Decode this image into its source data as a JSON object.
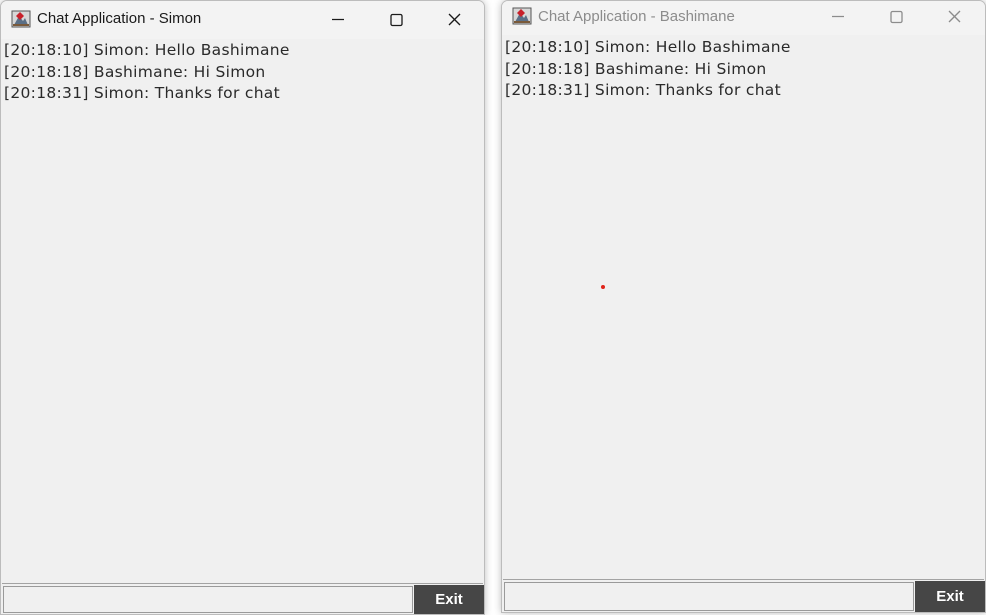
{
  "windows": {
    "left": {
      "title": "Chat Application - Simon",
      "messages": [
        "[20:18:10] Simon: Hello Bashimane",
        "[20:18:18] Bashimane: Hi Simon",
        "[20:18:31] Simon: Thanks for chat"
      ],
      "input_value": "",
      "exit_label": "Exit",
      "active": true
    },
    "right": {
      "title": "Chat Application - Bashimane",
      "messages": [
        "[20:18:10] Simon: Hello Bashimane",
        "[20:18:18] Bashimane: Hi Simon",
        "[20:18:31] Simon: Thanks for chat"
      ],
      "input_value": "",
      "exit_label": "Exit",
      "active": false
    }
  },
  "icons": {
    "app": "java-app-icon",
    "minimize": "minimize-icon",
    "maximize": "maximize-icon",
    "close": "close-icon",
    "cursor": "mouse-cursor-dot"
  },
  "colors": {
    "window_bg": "#f0f0f0",
    "exit_button_bg": "#464646",
    "exit_button_text": "#ffffff",
    "cursor_dot": "#e0241a",
    "inactive_title": "#8c8c8c"
  }
}
